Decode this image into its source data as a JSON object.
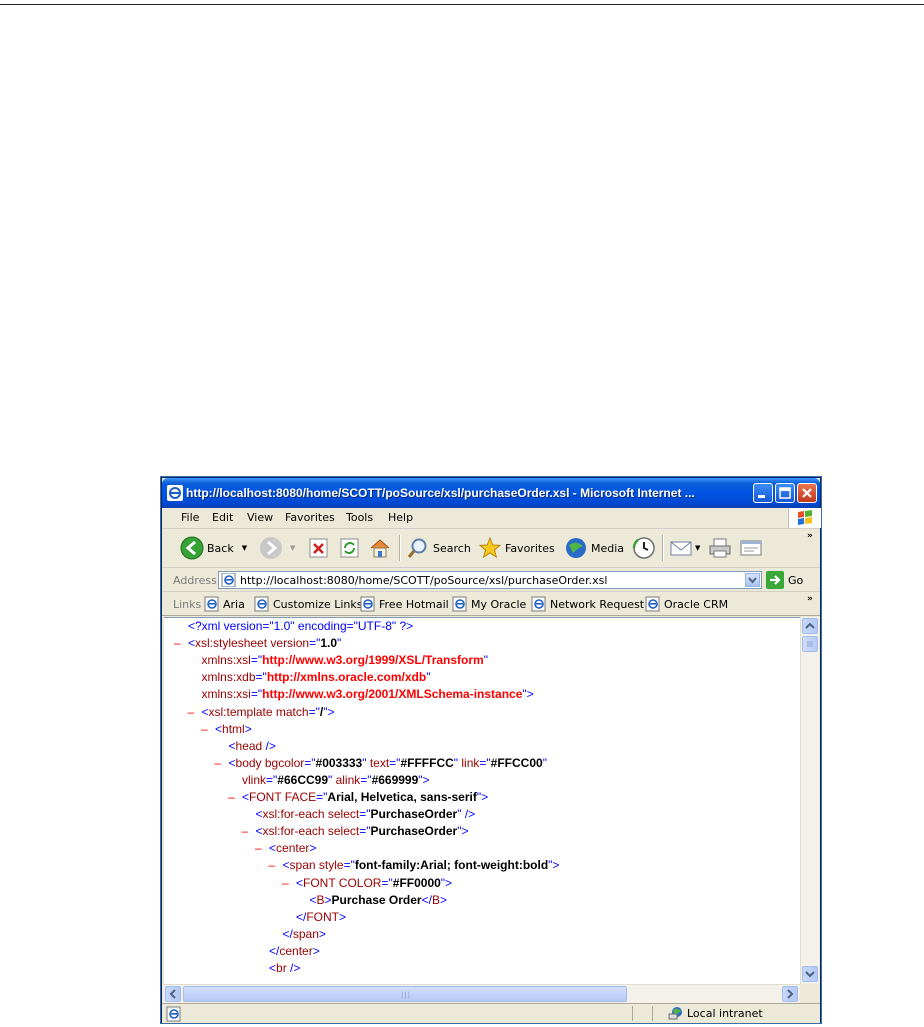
{
  "window": {
    "title": "http://localhost:8080/home/SCOTT/poSource/xsl/purchaseOrder.xsl - Microsoft Internet ..."
  },
  "menu": [
    "File",
    "Edit",
    "View",
    "Favorites",
    "Tools",
    "Help"
  ],
  "toolbar": {
    "back_label": "Back",
    "search_label": "Search",
    "favorites_label": "Favorites",
    "media_label": "Media"
  },
  "address": {
    "label": "Address",
    "url": "http://localhost:8080/home/SCOTT/poSource/xsl/purchaseOrder.xsl",
    "go_label": "Go"
  },
  "links": {
    "label": "Links",
    "items": [
      "Aria",
      "Customize Links",
      "Free Hotmail",
      "My Oracle",
      "Network Request",
      "Oracle CRM"
    ]
  },
  "xml_lines": [
    {
      "indent": 0,
      "minus": false,
      "parts": [
        [
          "pi",
          "<?xml version=\"1.0\" encoding=\"UTF-8\" ?>"
        ]
      ]
    },
    {
      "indent": 0,
      "minus": true,
      "parts": [
        [
          "mk",
          "<"
        ],
        [
          "tag",
          "xsl:stylesheet "
        ],
        [
          "attr",
          "version"
        ],
        [
          "mk",
          "=\""
        ],
        [
          "val",
          "1.0"
        ],
        [
          "mk",
          "\""
        ]
      ]
    },
    {
      "indent": 1,
      "minus": false,
      "parts": [
        [
          "attr",
          "xmlns:xsl"
        ],
        [
          "mk",
          "=\""
        ],
        [
          "ns",
          "http://www.w3.org/1999/XSL/Transform"
        ],
        [
          "mk",
          "\""
        ]
      ]
    },
    {
      "indent": 1,
      "minus": false,
      "parts": [
        [
          "attr",
          "xmlns:xdb"
        ],
        [
          "mk",
          "=\""
        ],
        [
          "ns",
          "http://xmlns.oracle.com/xdb"
        ],
        [
          "mk",
          "\""
        ]
      ]
    },
    {
      "indent": 1,
      "minus": false,
      "parts": [
        [
          "attr",
          "xmlns:xsi"
        ],
        [
          "mk",
          "=\""
        ],
        [
          "ns",
          "http://www.w3.org/2001/XMLSchema-instance"
        ],
        [
          "mk",
          "\">"
        ]
      ]
    },
    {
      "indent": 1,
      "minus": true,
      "parts": [
        [
          "mk",
          "<"
        ],
        [
          "tag",
          "xsl:template "
        ],
        [
          "attr",
          "match"
        ],
        [
          "mk",
          "=\""
        ],
        [
          "val",
          "/"
        ],
        [
          "mk",
          "\">"
        ]
      ]
    },
    {
      "indent": 2,
      "minus": true,
      "parts": [
        [
          "mk",
          "<"
        ],
        [
          "tag",
          "html"
        ],
        [
          "mk",
          ">"
        ]
      ]
    },
    {
      "indent": 3,
      "minus": false,
      "parts": [
        [
          "mk",
          "<"
        ],
        [
          "tag",
          "head"
        ],
        [
          "mk",
          " />"
        ]
      ]
    },
    {
      "indent": 3,
      "minus": true,
      "parts": [
        [
          "mk",
          "<"
        ],
        [
          "tag",
          "body "
        ],
        [
          "attr",
          "bgcolor"
        ],
        [
          "mk",
          "=\""
        ],
        [
          "val",
          "#003333"
        ],
        [
          "mk",
          "\" "
        ],
        [
          "attr",
          "text"
        ],
        [
          "mk",
          "=\""
        ],
        [
          "val",
          "#FFFFCC"
        ],
        [
          "mk",
          "\" "
        ],
        [
          "attr",
          "link"
        ],
        [
          "mk",
          "=\""
        ],
        [
          "val",
          "#FFCC00"
        ],
        [
          "mk",
          "\""
        ]
      ]
    },
    {
      "indent": 4,
      "minus": false,
      "parts": [
        [
          "attr",
          "vlink"
        ],
        [
          "mk",
          "=\""
        ],
        [
          "val",
          "#66CC99"
        ],
        [
          "mk",
          "\" "
        ],
        [
          "attr",
          "alink"
        ],
        [
          "mk",
          "=\""
        ],
        [
          "val",
          "#669999"
        ],
        [
          "mk",
          "\">"
        ]
      ]
    },
    {
      "indent": 4,
      "minus": true,
      "parts": [
        [
          "mk",
          "<"
        ],
        [
          "tag",
          "FONT "
        ],
        [
          "attr",
          "FACE"
        ],
        [
          "mk",
          "=\""
        ],
        [
          "val",
          "Arial, Helvetica, sans-serif"
        ],
        [
          "mk",
          "\">"
        ]
      ]
    },
    {
      "indent": 5,
      "minus": false,
      "parts": [
        [
          "mk",
          "<"
        ],
        [
          "tag",
          "xsl:for-each "
        ],
        [
          "attr",
          "select"
        ],
        [
          "mk",
          "=\""
        ],
        [
          "val",
          "PurchaseOrder"
        ],
        [
          "mk",
          "\" />"
        ]
      ]
    },
    {
      "indent": 5,
      "minus": true,
      "parts": [
        [
          "mk",
          "<"
        ],
        [
          "tag",
          "xsl:for-each "
        ],
        [
          "attr",
          "select"
        ],
        [
          "mk",
          "=\""
        ],
        [
          "val",
          "PurchaseOrder"
        ],
        [
          "mk",
          "\">"
        ]
      ]
    },
    {
      "indent": 6,
      "minus": true,
      "parts": [
        [
          "mk",
          "<"
        ],
        [
          "tag",
          "center"
        ],
        [
          "mk",
          ">"
        ]
      ]
    },
    {
      "indent": 7,
      "minus": true,
      "parts": [
        [
          "mk",
          "<"
        ],
        [
          "tag",
          "span "
        ],
        [
          "attr",
          "style"
        ],
        [
          "mk",
          "=\""
        ],
        [
          "val",
          "font-family:Arial; font-weight:bold"
        ],
        [
          "mk",
          "\">"
        ]
      ]
    },
    {
      "indent": 8,
      "minus": true,
      "parts": [
        [
          "mk",
          "<"
        ],
        [
          "tag",
          "FONT "
        ],
        [
          "attr",
          "COLOR"
        ],
        [
          "mk",
          "=\""
        ],
        [
          "val",
          "#FF0000"
        ],
        [
          "mk",
          "\">"
        ]
      ]
    },
    {
      "indent": 9,
      "minus": false,
      "parts": [
        [
          "mk",
          "<"
        ],
        [
          "tag",
          "B"
        ],
        [
          "mk",
          ">"
        ],
        [
          "val",
          "Purchase Order"
        ],
        [
          "mk",
          "</"
        ],
        [
          "tag",
          "B"
        ],
        [
          "mk",
          ">"
        ]
      ]
    },
    {
      "indent": 8,
      "minus": false,
      "parts": [
        [
          "mk",
          "</"
        ],
        [
          "tag",
          "FONT"
        ],
        [
          "mk",
          ">"
        ]
      ]
    },
    {
      "indent": 7,
      "minus": false,
      "parts": [
        [
          "mk",
          "</"
        ],
        [
          "tag",
          "span"
        ],
        [
          "mk",
          ">"
        ]
      ]
    },
    {
      "indent": 6,
      "minus": false,
      "parts": [
        [
          "mk",
          "</"
        ],
        [
          "tag",
          "center"
        ],
        [
          "mk",
          ">"
        ]
      ]
    },
    {
      "indent": 6,
      "minus": false,
      "parts": [
        [
          "mk",
          "<"
        ],
        [
          "tag",
          "br"
        ],
        [
          "mk",
          " />"
        ]
      ]
    }
  ],
  "status": {
    "zone_label": "Local intranet"
  }
}
